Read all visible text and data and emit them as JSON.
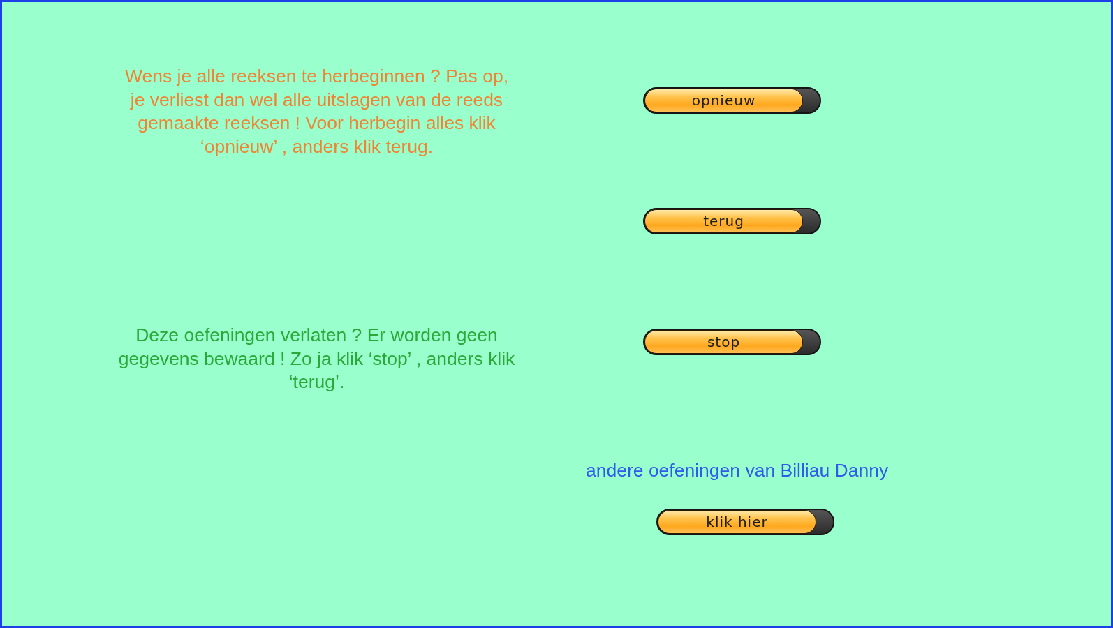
{
  "messages": [
    {
      "text": "Wens je alle reeksen te herbeginnen ? Pas op, je verliest dan wel alle uitslagen van de reeds gemaakte reeksen ! Voor herbegin alles klik ‘opnieuw’ , anders klik terug.",
      "color": "#ef8434"
    },
    {
      "text": "Deze oefeningen verlaten ? Er worden geen gegevens bewaard ! Zo ja klik ‘stop’ , anders klik ‘terug’.",
      "color": "#2aa838"
    }
  ],
  "buttons": [
    {
      "label": "opnieuw"
    },
    {
      "label": "terug"
    },
    {
      "label": "stop"
    }
  ],
  "credit": {
    "text": "andere oefeningen van Billiau Danny",
    "button": "klik hier"
  }
}
